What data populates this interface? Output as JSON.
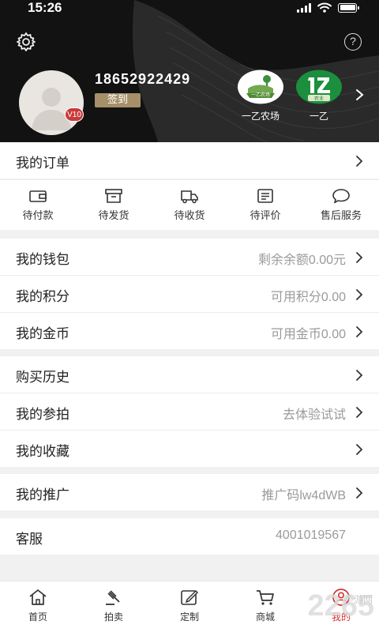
{
  "status": {
    "time": "15:26"
  },
  "profile": {
    "phone": "18652922429",
    "signin_label": "签到",
    "vip_badge": "V10",
    "help_glyph": "?"
  },
  "shops": [
    {
      "name": "一乙农场",
      "logo_text": "一乙农场"
    },
    {
      "name": "一乙",
      "logo_text": "农业"
    }
  ],
  "orders": {
    "title": "我的订单",
    "items": [
      {
        "label": "待付款",
        "icon": "wallet-icon"
      },
      {
        "label": "待发货",
        "icon": "box-icon"
      },
      {
        "label": "待收货",
        "icon": "truck-icon"
      },
      {
        "label": "待评价",
        "icon": "review-icon"
      },
      {
        "label": "售后服务",
        "icon": "chat-icon"
      }
    ]
  },
  "menu": {
    "wallet": {
      "label": "我的钱包",
      "value": "剩余余额0.00元"
    },
    "points": {
      "label": "我的积分",
      "value": "可用积分0.00"
    },
    "coins": {
      "label": "我的金币",
      "value": "可用金币0.00"
    },
    "history": {
      "label": "购买历史",
      "value": ""
    },
    "auction": {
      "label": "我的参拍",
      "value": "去体验试试"
    },
    "favorites": {
      "label": "我的收藏",
      "value": ""
    },
    "promo": {
      "label": "我的推广",
      "value": "推广码lw4dWB"
    },
    "service": {
      "label": "客服",
      "value": "4001019567"
    }
  },
  "tabs": [
    {
      "label": "首页",
      "icon": "home-icon"
    },
    {
      "label": "拍卖",
      "icon": "gavel-icon"
    },
    {
      "label": "定制",
      "icon": "edit-icon"
    },
    {
      "label": "商城",
      "icon": "cart-icon"
    },
    {
      "label": "我的",
      "icon": "user-icon",
      "active": true
    }
  ],
  "watermark": {
    "brand": "2265",
    "sub": "手游网"
  },
  "colors": {
    "header_bg": "#121212",
    "signin_bg": "#a59069",
    "active_tab": "#d0332f",
    "vip_badge": "#c93a3a"
  }
}
